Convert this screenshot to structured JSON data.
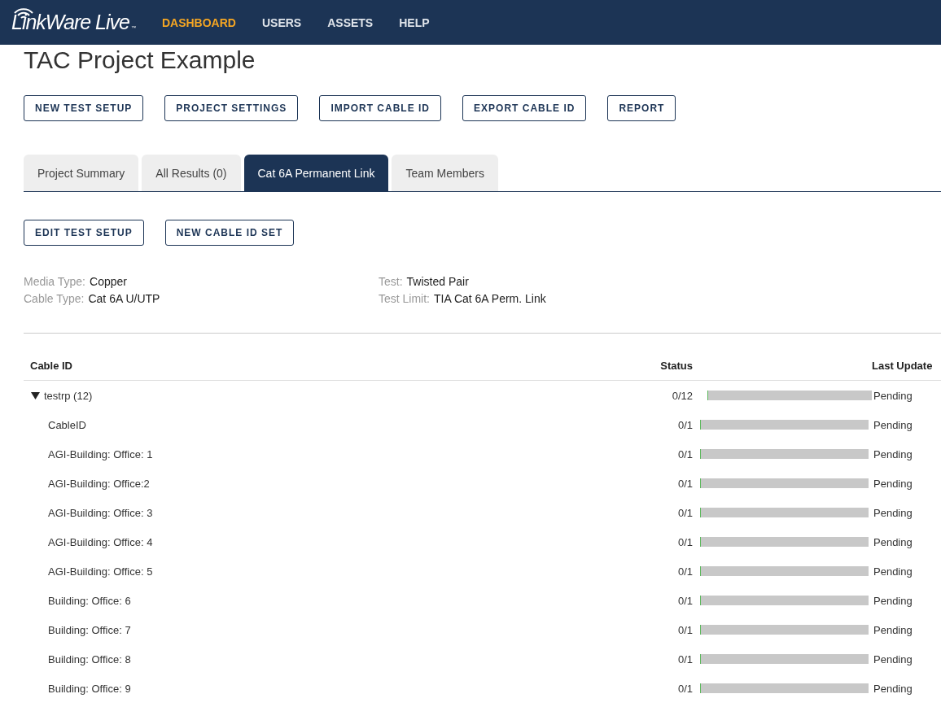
{
  "nav": {
    "logo": "LinkWare Live",
    "logo_mark": "™",
    "items": [
      {
        "label": "DASHBOARD",
        "selected": true
      },
      {
        "label": "USERS",
        "selected": false
      },
      {
        "label": "ASSETS",
        "selected": false
      },
      {
        "label": "HELP",
        "selected": false
      }
    ]
  },
  "title": "TAC Project Example",
  "actions": [
    "NEW TEST SETUP",
    "PROJECT SETTINGS",
    "IMPORT CABLE ID",
    "EXPORT CABLE ID",
    "REPORT"
  ],
  "tabs": [
    {
      "label": "Project Summary",
      "selected": false
    },
    {
      "label": "All Results (0)",
      "selected": false
    },
    {
      "label": "Cat 6A Permanent Link",
      "selected": true
    },
    {
      "label": "Team Members",
      "selected": false
    }
  ],
  "setup_actions": [
    "EDIT TEST SETUP",
    "NEW CABLE ID SET"
  ],
  "details": [
    {
      "label": "Media Type:",
      "value": "Copper"
    },
    {
      "label": "Test:",
      "value": "Twisted Pair"
    },
    {
      "label": "Cable Type:",
      "value": "Cat 6A U/UTP"
    },
    {
      "label": "Test Limit:",
      "value": "TIA Cat 6A Perm. Link"
    }
  ],
  "table": {
    "columns": [
      "Cable ID",
      "Status",
      "Last Update"
    ],
    "rows": [
      {
        "name": "testrp (12)",
        "expanded": true,
        "count": "0/12",
        "level": 0,
        "update": "Pending",
        "children": [
          {
            "name": "CableID",
            "count": "0/1",
            "level": 0,
            "update": "Pending"
          },
          {
            "name": "AGI-Building: Office: 1",
            "count": "0/1",
            "level": 0,
            "update": "Pending"
          },
          {
            "name": "AGI-Building: Office:2",
            "count": "0/1",
            "level": 0,
            "update": "Pending"
          },
          {
            "name": "AGI-Building: Office: 3",
            "count": "0/1",
            "level": 0,
            "update": "Pending"
          },
          {
            "name": "AGI-Building: Office: 4",
            "count": "0/1",
            "level": 0,
            "update": "Pending"
          },
          {
            "name": "AGI-Building: Office: 5",
            "count": "0/1",
            "level": 0,
            "update": "Pending"
          },
          {
            "name": "Building: Office: 6",
            "count": "0/1",
            "level": 0,
            "update": "Pending"
          },
          {
            "name": "Building: Office: 7",
            "count": "0/1",
            "level": 0,
            "update": "Pending"
          },
          {
            "name": "Building: Office: 8",
            "count": "0/1",
            "level": 0,
            "update": "Pending"
          },
          {
            "name": "Building: Office: 9",
            "count": "0/1",
            "level": 0,
            "update": "Pending"
          }
        ]
      }
    ]
  }
}
